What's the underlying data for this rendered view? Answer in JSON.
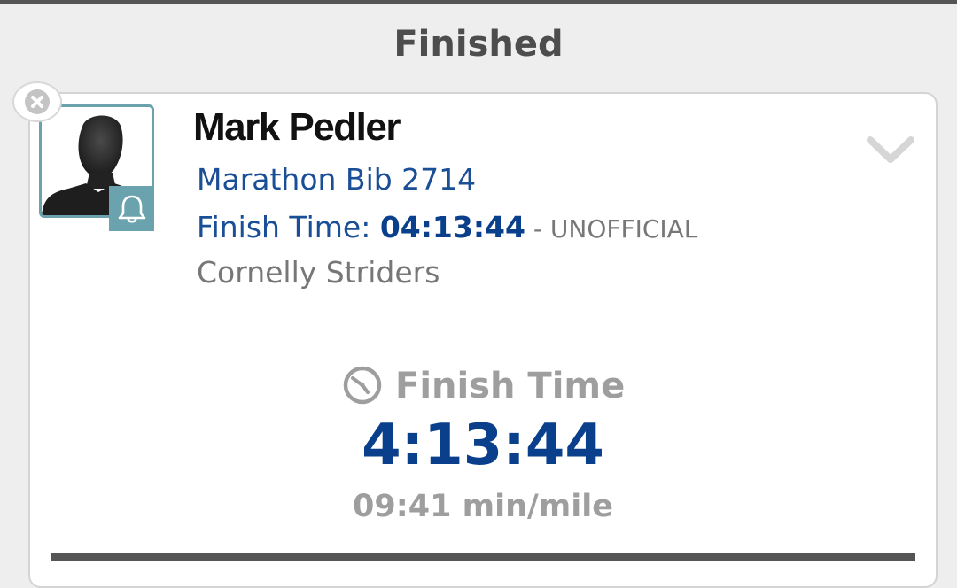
{
  "section": {
    "title": "Finished"
  },
  "runner": {
    "name": "Mark Pedler",
    "bib": "Marathon Bib 2714",
    "finish_label": "Finish Time: ",
    "finish_value": "04:13:44",
    "finish_status": " - UNOFFICIAL",
    "club": "Cornelly Striders"
  },
  "finish_summary": {
    "heading": "Finish Time",
    "time": "4:13:44",
    "pace": "09:41 min/mile"
  },
  "icons": {
    "remove": "close-circle-icon",
    "avatar": "person-silhouette-icon",
    "alert": "bell-icon",
    "expand": "chevron-down-icon",
    "clock": "clock-icon"
  },
  "colors": {
    "accent_blue": "#1a4e96",
    "time_blue": "#0a3f8c",
    "badge_teal": "#6aa3ad",
    "muted_gray": "#777777"
  }
}
